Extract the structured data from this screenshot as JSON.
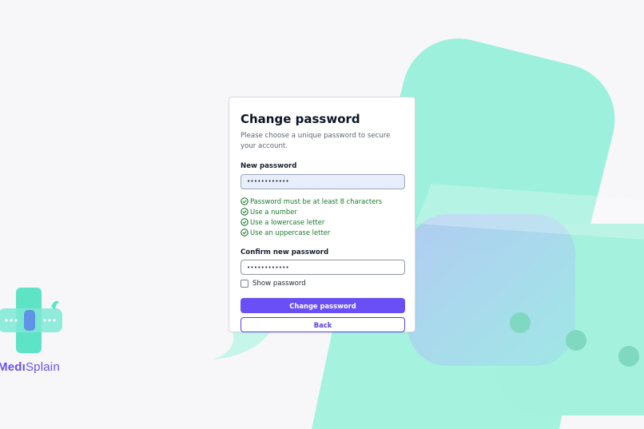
{
  "form": {
    "title": "Change password",
    "subtitle": "Please choose a unique password to secure your account.",
    "new_password_label": "New password",
    "new_password_value": "••••••••••••",
    "rules": [
      "Password must be at least 8 characters",
      "Use a number",
      "Use a lowercase letter",
      "Use an uppercase letter"
    ],
    "confirm_password_label": "Confirm new password",
    "confirm_password_value": "••••••••••••",
    "show_password_label": "Show password",
    "show_password_checked": false,
    "submit_label": "Change password",
    "back_label": "Back"
  },
  "brand": {
    "name_bold": "Medı",
    "name_regular": "Splain"
  },
  "colors": {
    "accent": "#6a4ef6",
    "success": "#1a7a2c",
    "mint": "#9ef0dc",
    "lavender": "#a9d0f0"
  },
  "icons": {
    "rule_icon": "check-circle-icon",
    "logo_icon": "medical-cross-chat-icon"
  }
}
